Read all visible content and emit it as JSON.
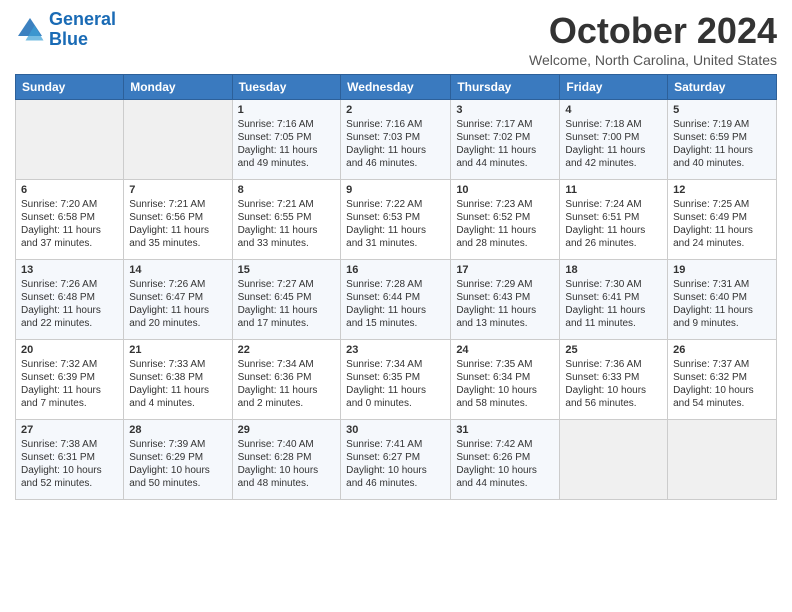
{
  "header": {
    "logo_line1": "General",
    "logo_line2": "Blue",
    "month": "October 2024",
    "location": "Welcome, North Carolina, United States"
  },
  "days_of_week": [
    "Sunday",
    "Monday",
    "Tuesday",
    "Wednesday",
    "Thursday",
    "Friday",
    "Saturday"
  ],
  "weeks": [
    [
      {
        "num": "",
        "sunrise": "",
        "sunset": "",
        "daylight": ""
      },
      {
        "num": "",
        "sunrise": "",
        "sunset": "",
        "daylight": ""
      },
      {
        "num": "1",
        "sunrise": "Sunrise: 7:16 AM",
        "sunset": "Sunset: 7:05 PM",
        "daylight": "Daylight: 11 hours and 49 minutes."
      },
      {
        "num": "2",
        "sunrise": "Sunrise: 7:16 AM",
        "sunset": "Sunset: 7:03 PM",
        "daylight": "Daylight: 11 hours and 46 minutes."
      },
      {
        "num": "3",
        "sunrise": "Sunrise: 7:17 AM",
        "sunset": "Sunset: 7:02 PM",
        "daylight": "Daylight: 11 hours and 44 minutes."
      },
      {
        "num": "4",
        "sunrise": "Sunrise: 7:18 AM",
        "sunset": "Sunset: 7:00 PM",
        "daylight": "Daylight: 11 hours and 42 minutes."
      },
      {
        "num": "5",
        "sunrise": "Sunrise: 7:19 AM",
        "sunset": "Sunset: 6:59 PM",
        "daylight": "Daylight: 11 hours and 40 minutes."
      }
    ],
    [
      {
        "num": "6",
        "sunrise": "Sunrise: 7:20 AM",
        "sunset": "Sunset: 6:58 PM",
        "daylight": "Daylight: 11 hours and 37 minutes."
      },
      {
        "num": "7",
        "sunrise": "Sunrise: 7:21 AM",
        "sunset": "Sunset: 6:56 PM",
        "daylight": "Daylight: 11 hours and 35 minutes."
      },
      {
        "num": "8",
        "sunrise": "Sunrise: 7:21 AM",
        "sunset": "Sunset: 6:55 PM",
        "daylight": "Daylight: 11 hours and 33 minutes."
      },
      {
        "num": "9",
        "sunrise": "Sunrise: 7:22 AM",
        "sunset": "Sunset: 6:53 PM",
        "daylight": "Daylight: 11 hours and 31 minutes."
      },
      {
        "num": "10",
        "sunrise": "Sunrise: 7:23 AM",
        "sunset": "Sunset: 6:52 PM",
        "daylight": "Daylight: 11 hours and 28 minutes."
      },
      {
        "num": "11",
        "sunrise": "Sunrise: 7:24 AM",
        "sunset": "Sunset: 6:51 PM",
        "daylight": "Daylight: 11 hours and 26 minutes."
      },
      {
        "num": "12",
        "sunrise": "Sunrise: 7:25 AM",
        "sunset": "Sunset: 6:49 PM",
        "daylight": "Daylight: 11 hours and 24 minutes."
      }
    ],
    [
      {
        "num": "13",
        "sunrise": "Sunrise: 7:26 AM",
        "sunset": "Sunset: 6:48 PM",
        "daylight": "Daylight: 11 hours and 22 minutes."
      },
      {
        "num": "14",
        "sunrise": "Sunrise: 7:26 AM",
        "sunset": "Sunset: 6:47 PM",
        "daylight": "Daylight: 11 hours and 20 minutes."
      },
      {
        "num": "15",
        "sunrise": "Sunrise: 7:27 AM",
        "sunset": "Sunset: 6:45 PM",
        "daylight": "Daylight: 11 hours and 17 minutes."
      },
      {
        "num": "16",
        "sunrise": "Sunrise: 7:28 AM",
        "sunset": "Sunset: 6:44 PM",
        "daylight": "Daylight: 11 hours and 15 minutes."
      },
      {
        "num": "17",
        "sunrise": "Sunrise: 7:29 AM",
        "sunset": "Sunset: 6:43 PM",
        "daylight": "Daylight: 11 hours and 13 minutes."
      },
      {
        "num": "18",
        "sunrise": "Sunrise: 7:30 AM",
        "sunset": "Sunset: 6:41 PM",
        "daylight": "Daylight: 11 hours and 11 minutes."
      },
      {
        "num": "19",
        "sunrise": "Sunrise: 7:31 AM",
        "sunset": "Sunset: 6:40 PM",
        "daylight": "Daylight: 11 hours and 9 minutes."
      }
    ],
    [
      {
        "num": "20",
        "sunrise": "Sunrise: 7:32 AM",
        "sunset": "Sunset: 6:39 PM",
        "daylight": "Daylight: 11 hours and 7 minutes."
      },
      {
        "num": "21",
        "sunrise": "Sunrise: 7:33 AM",
        "sunset": "Sunset: 6:38 PM",
        "daylight": "Daylight: 11 hours and 4 minutes."
      },
      {
        "num": "22",
        "sunrise": "Sunrise: 7:34 AM",
        "sunset": "Sunset: 6:36 PM",
        "daylight": "Daylight: 11 hours and 2 minutes."
      },
      {
        "num": "23",
        "sunrise": "Sunrise: 7:34 AM",
        "sunset": "Sunset: 6:35 PM",
        "daylight": "Daylight: 11 hours and 0 minutes."
      },
      {
        "num": "24",
        "sunrise": "Sunrise: 7:35 AM",
        "sunset": "Sunset: 6:34 PM",
        "daylight": "Daylight: 10 hours and 58 minutes."
      },
      {
        "num": "25",
        "sunrise": "Sunrise: 7:36 AM",
        "sunset": "Sunset: 6:33 PM",
        "daylight": "Daylight: 10 hours and 56 minutes."
      },
      {
        "num": "26",
        "sunrise": "Sunrise: 7:37 AM",
        "sunset": "Sunset: 6:32 PM",
        "daylight": "Daylight: 10 hours and 54 minutes."
      }
    ],
    [
      {
        "num": "27",
        "sunrise": "Sunrise: 7:38 AM",
        "sunset": "Sunset: 6:31 PM",
        "daylight": "Daylight: 10 hours and 52 minutes."
      },
      {
        "num": "28",
        "sunrise": "Sunrise: 7:39 AM",
        "sunset": "Sunset: 6:29 PM",
        "daylight": "Daylight: 10 hours and 50 minutes."
      },
      {
        "num": "29",
        "sunrise": "Sunrise: 7:40 AM",
        "sunset": "Sunset: 6:28 PM",
        "daylight": "Daylight: 10 hours and 48 minutes."
      },
      {
        "num": "30",
        "sunrise": "Sunrise: 7:41 AM",
        "sunset": "Sunset: 6:27 PM",
        "daylight": "Daylight: 10 hours and 46 minutes."
      },
      {
        "num": "31",
        "sunrise": "Sunrise: 7:42 AM",
        "sunset": "Sunset: 6:26 PM",
        "daylight": "Daylight: 10 hours and 44 minutes."
      },
      {
        "num": "",
        "sunrise": "",
        "sunset": "",
        "daylight": ""
      },
      {
        "num": "",
        "sunrise": "",
        "sunset": "",
        "daylight": ""
      }
    ]
  ]
}
